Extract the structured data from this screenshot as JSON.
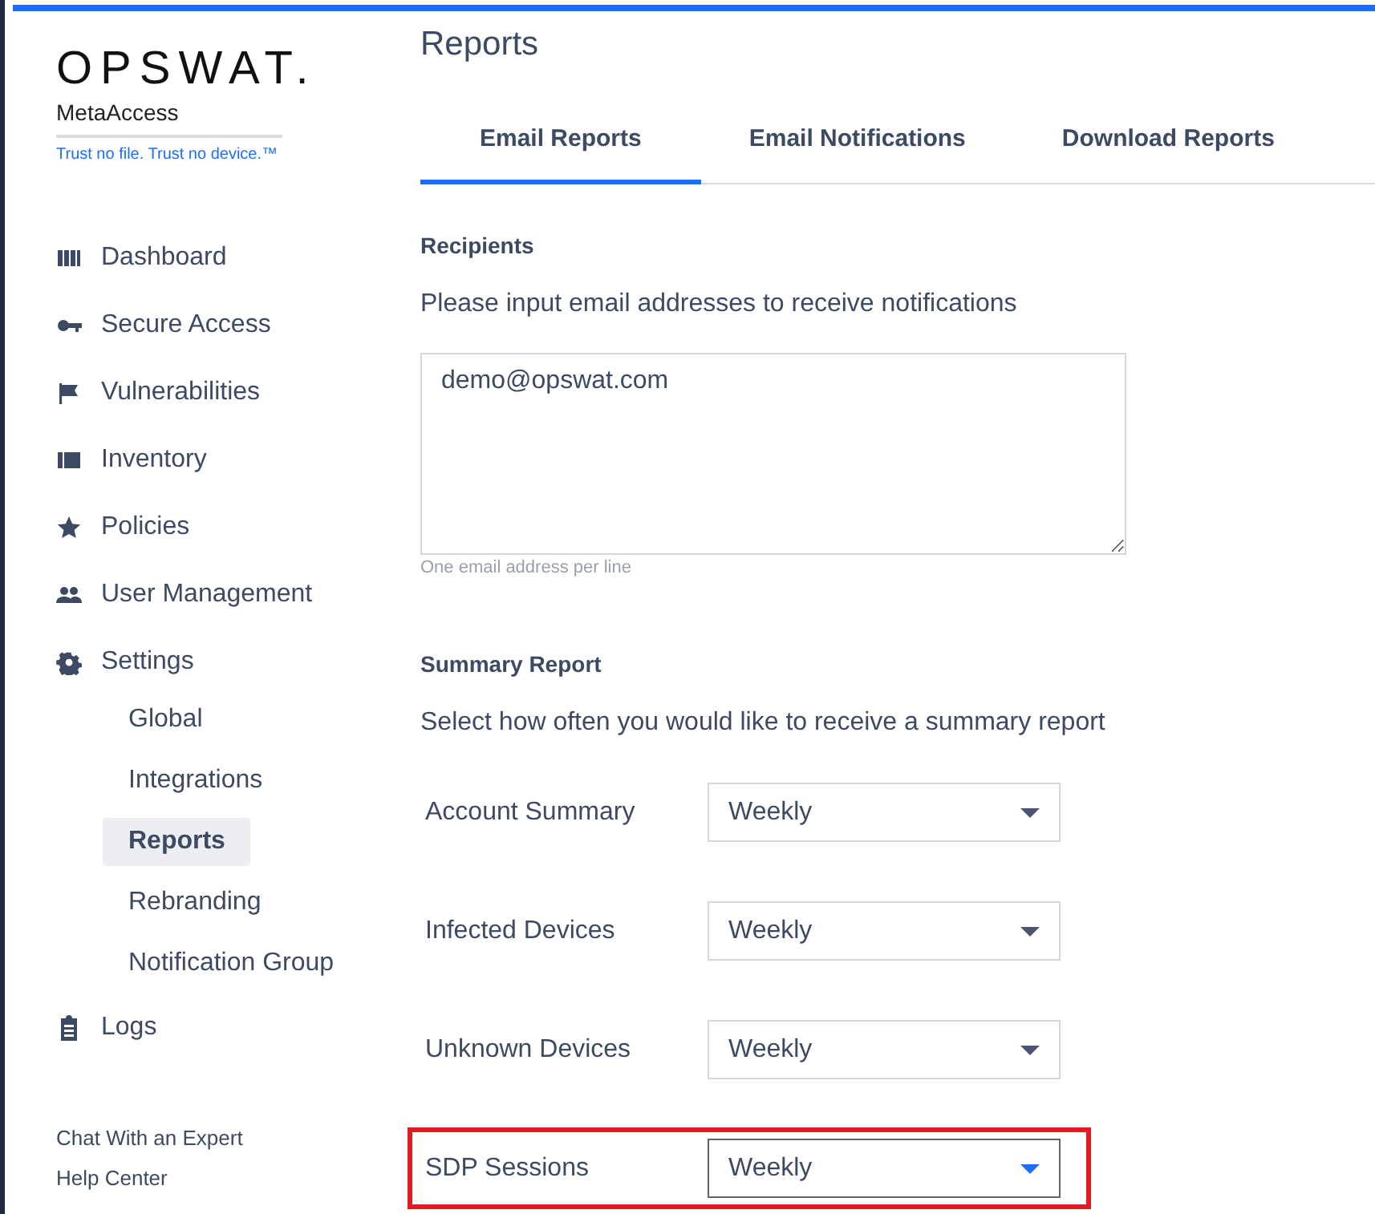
{
  "brand": {
    "logo": "OPSWAT.",
    "product": "MetaAccess",
    "tagline": "Trust no file. Trust no device.™"
  },
  "sidebar": {
    "items": [
      {
        "label": "Dashboard",
        "selected": false
      },
      {
        "label": "Secure Access",
        "selected": false
      },
      {
        "label": "Vulnerabilities",
        "selected": false
      },
      {
        "label": "Inventory",
        "selected": false
      },
      {
        "label": "Policies",
        "selected": false
      },
      {
        "label": "User Management",
        "selected": false
      },
      {
        "label": "Settings",
        "selected": false,
        "children": [
          {
            "label": "Global",
            "selected": false
          },
          {
            "label": "Integrations",
            "selected": false
          },
          {
            "label": "Reports",
            "selected": true
          },
          {
            "label": "Rebranding",
            "selected": false
          },
          {
            "label": "Notification Group",
            "selected": false
          }
        ]
      },
      {
        "label": "Logs",
        "selected": false
      }
    ],
    "footer_links": [
      "Chat With an Expert",
      "Help Center"
    ]
  },
  "page": {
    "title": "Reports",
    "tabs": [
      {
        "label": "Email Reports",
        "selected": true
      },
      {
        "label": "Email Notifications",
        "selected": false
      },
      {
        "label": "Download Reports",
        "selected": false
      }
    ],
    "recipients": {
      "heading": "Recipients",
      "description": "Please input email addresses to receive notifications",
      "value": "demo@opswat.com",
      "hint": "One email address per line"
    },
    "summary": {
      "heading": "Summary Report",
      "description": "Select how often you would like to receive a summary report",
      "rows": [
        {
          "label": "Account Summary",
          "value": "Weekly",
          "focused": false,
          "highlighted": false
        },
        {
          "label": "Infected Devices",
          "value": "Weekly",
          "focused": false,
          "highlighted": false
        },
        {
          "label": "Unknown Devices",
          "value": "Weekly",
          "focused": false,
          "highlighted": false
        },
        {
          "label": "SDP Sessions",
          "value": "Weekly",
          "focused": true,
          "highlighted": true
        }
      ]
    }
  }
}
